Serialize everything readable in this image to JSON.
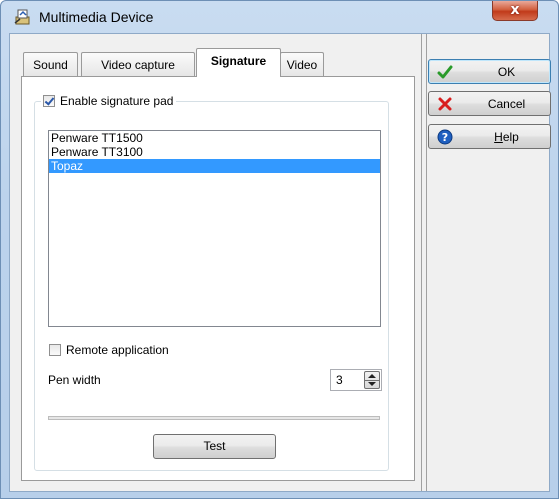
{
  "window": {
    "title": "Multimedia Device",
    "close_glyph": "x"
  },
  "tabs": [
    {
      "label": "Sound",
      "active": false
    },
    {
      "label": "Video capture",
      "active": false
    },
    {
      "label": "Signature",
      "active": true
    },
    {
      "label": "Video",
      "active": false
    }
  ],
  "signature": {
    "enable_label": "Enable signature pad",
    "enable_checked": true,
    "devices": [
      "Penware TT1500",
      "Penware TT3100",
      "Topaz"
    ],
    "selected_device": "Topaz",
    "remote_label": "Remote application",
    "remote_checked": false,
    "pen_width_label": "Pen width",
    "pen_width_value": "3",
    "progress": 0,
    "test_label": "Test"
  },
  "buttons": {
    "ok": "OK",
    "cancel": "Cancel",
    "help": "Help"
  },
  "icons": {
    "title": "device-icon",
    "ok": "green-check-icon",
    "cancel": "red-x-icon",
    "help": "help-question-icon"
  },
  "colors": {
    "selection": "#3399ff",
    "ok_check": "#2a9a2a",
    "cancel_x": "#d81e1e",
    "help_blue": "#1f5fc0"
  }
}
